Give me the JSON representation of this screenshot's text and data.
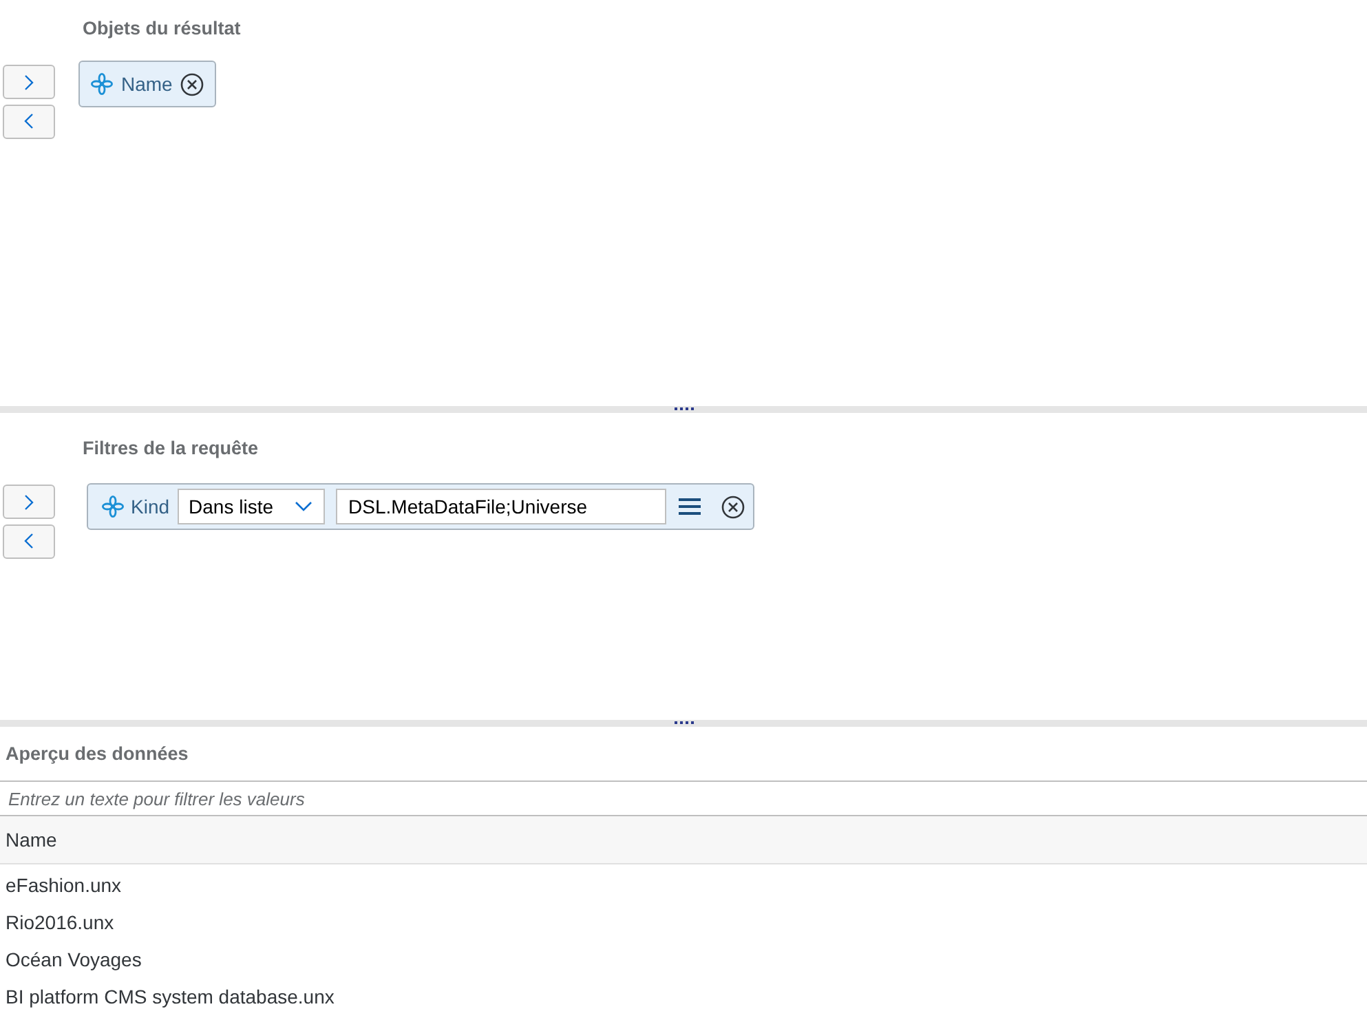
{
  "result_objects": {
    "title": "Objets du résultat",
    "items": [
      {
        "label": "Name"
      }
    ]
  },
  "query_filters": {
    "title": "Filtres de la requête",
    "items": [
      {
        "object": "Kind",
        "operator": "Dans liste",
        "value": "DSL.MetaDataFile;Universe"
      }
    ]
  },
  "data_preview": {
    "title": "Aperçu des données",
    "filter": {
      "placeholder": "Entrez un texte pour filtrer les valeurs"
    },
    "columns": [
      "Name"
    ],
    "rows": [
      [
        "eFashion.unx"
      ],
      [
        "Rio2016.unx"
      ],
      [
        "Océan Voyages"
      ],
      [
        "BI platform CMS system database.unx"
      ]
    ]
  }
}
